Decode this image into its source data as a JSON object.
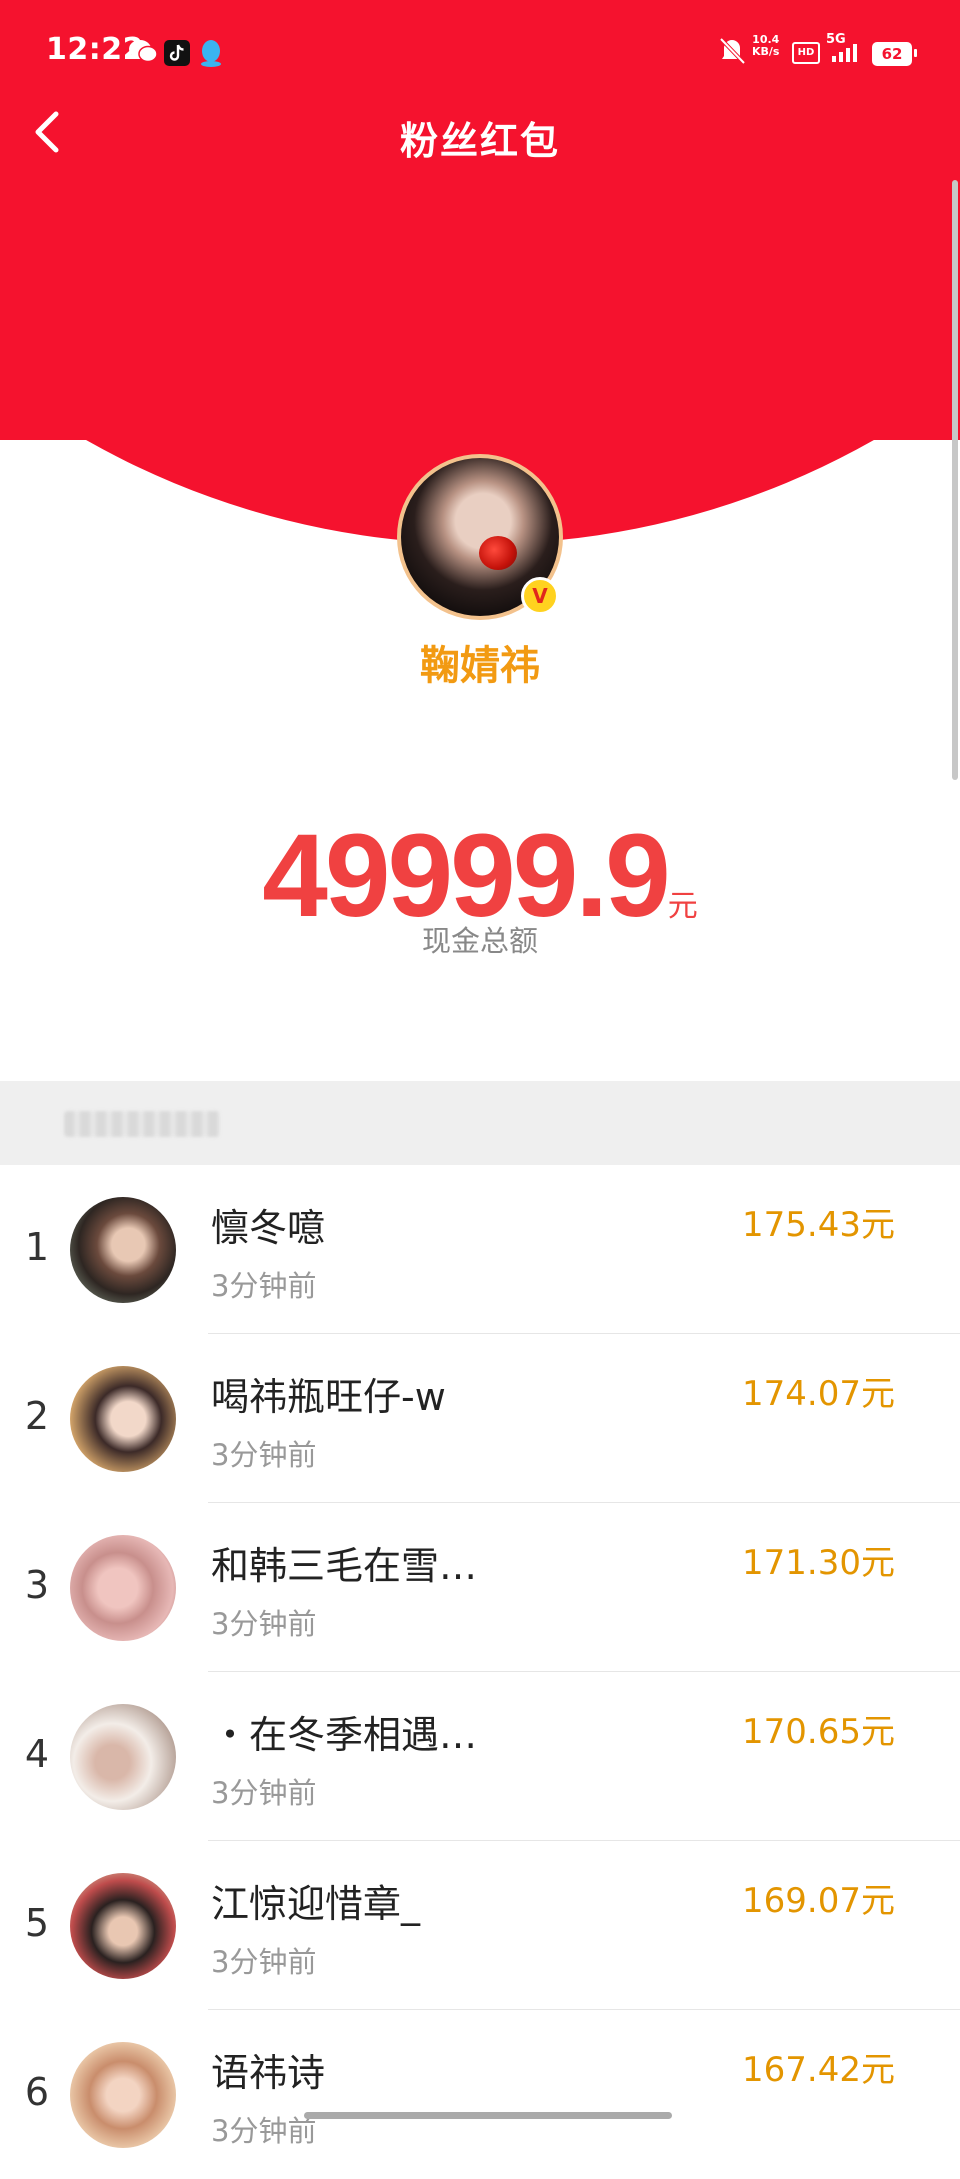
{
  "status_bar": {
    "time": "12:22",
    "net_speed_value": "10.4",
    "net_speed_unit": "KB/s",
    "hd": "HD",
    "network": "5G",
    "battery": "62"
  },
  "header": {
    "title": "粉丝红包",
    "back_icon": "chevron-left-icon"
  },
  "owner": {
    "name": "鞠婧祎",
    "verified_badge": "V"
  },
  "total": {
    "amount": "49999.9",
    "unit": "元",
    "label": "现金总额"
  },
  "colors": {
    "header_red": "#f5122e",
    "amount_red": "#f04141",
    "gold": "#e39500",
    "name_orange": "#f29a12"
  },
  "list": [
    {
      "rank": "1",
      "name": "懔冬噫",
      "time": "3分钟前",
      "amount": "175.43元"
    },
    {
      "rank": "2",
      "name": "喝祎瓶旺仔-w",
      "time": "3分钟前",
      "amount": "174.07元"
    },
    {
      "rank": "3",
      "name": "和韩三毛在雪…",
      "time": "3分钟前",
      "amount": "171.30元"
    },
    {
      "rank": "4",
      "name": "・在冬季相遇…",
      "time": "3分钟前",
      "amount": "170.65元"
    },
    {
      "rank": "5",
      "name": "江惊迎惜章_",
      "time": "3分钟前",
      "amount": "169.07元"
    },
    {
      "rank": "6",
      "name": "语祎诗",
      "time": "3分钟前",
      "amount": "167.42元"
    }
  ]
}
